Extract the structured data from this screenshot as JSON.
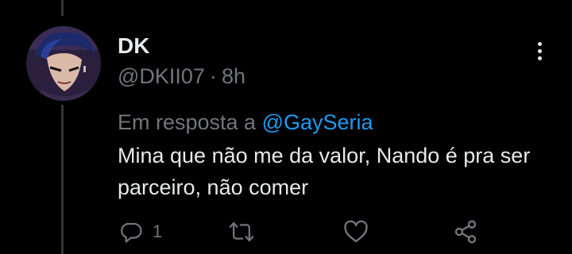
{
  "tweet": {
    "display_name": "DK",
    "handle": "@DKII07",
    "separator": "·",
    "time": "8h",
    "reply_prefix": "Em resposta a",
    "reply_mention": "@GaySeria",
    "text": "Mina que não me da valor, Nando é pra ser parceiro, não comer",
    "reply_count": "1"
  },
  "icons": {
    "avatar": "anime-character-avatar",
    "more": "more-options-icon",
    "reply": "reply-icon",
    "retweet": "retweet-icon",
    "like": "heart-icon",
    "share": "share-icon"
  },
  "colors": {
    "background": "#000000",
    "primary_text": "#e7e9ea",
    "secondary_text": "#71767b",
    "mention": "#1d9bf0"
  }
}
